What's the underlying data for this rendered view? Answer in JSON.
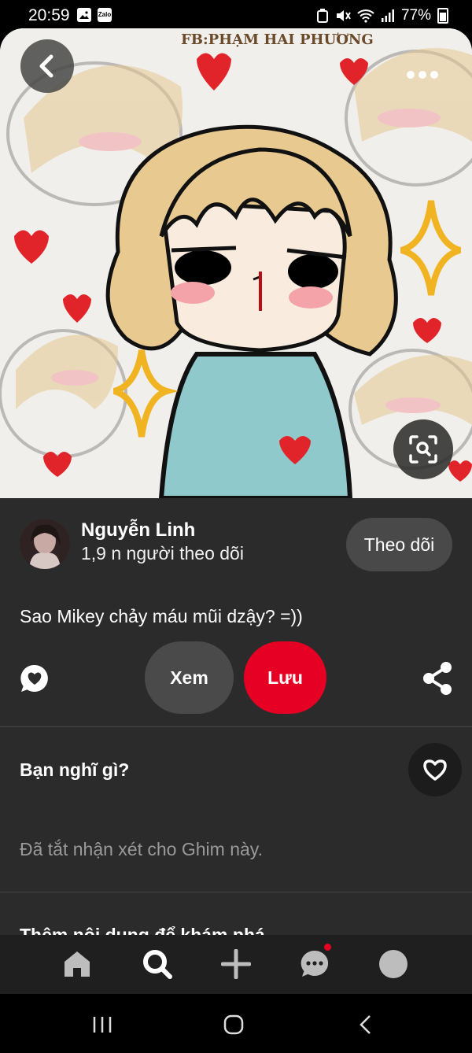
{
  "status_bar": {
    "time": "20:59",
    "battery": "77%",
    "notification_icons": [
      "gallery-icon",
      "zalo-icon"
    ],
    "zalo_label": "Zalo",
    "system_icons": [
      "recycle-icon",
      "mute-icon",
      "wifi-icon",
      "signal-icon",
      "battery-icon"
    ]
  },
  "pin": {
    "image_watermark": "FB:PHẠM HAI PHƯƠNG",
    "colors": {
      "hair": "#e8c98f",
      "shirt": "#8fc9cb",
      "heart": "#e0242a",
      "sparkle": "#f0b422"
    }
  },
  "creator": {
    "name": "Nguyễn Linh",
    "followers": "1,9 n người theo dõi",
    "follow_label": "Theo dõi"
  },
  "description": "Sao Mikey chảy máu mũi dzậy? =))",
  "actions": {
    "view_label": "Xem",
    "save_label": "Lưu"
  },
  "comments": {
    "heading": "Bạn nghĩ gì?",
    "disabled_text": "Đã tắt nhận xét cho Ghim này."
  },
  "more_ideas_heading": "Thêm nội dung để khám phá",
  "colors": {
    "accent": "#e60023",
    "panel": "#2b2b2b",
    "nav": "#1f1f1f"
  },
  "bottom_nav": [
    "home-icon",
    "search-icon",
    "create-icon",
    "messages-icon",
    "profile-icon"
  ]
}
